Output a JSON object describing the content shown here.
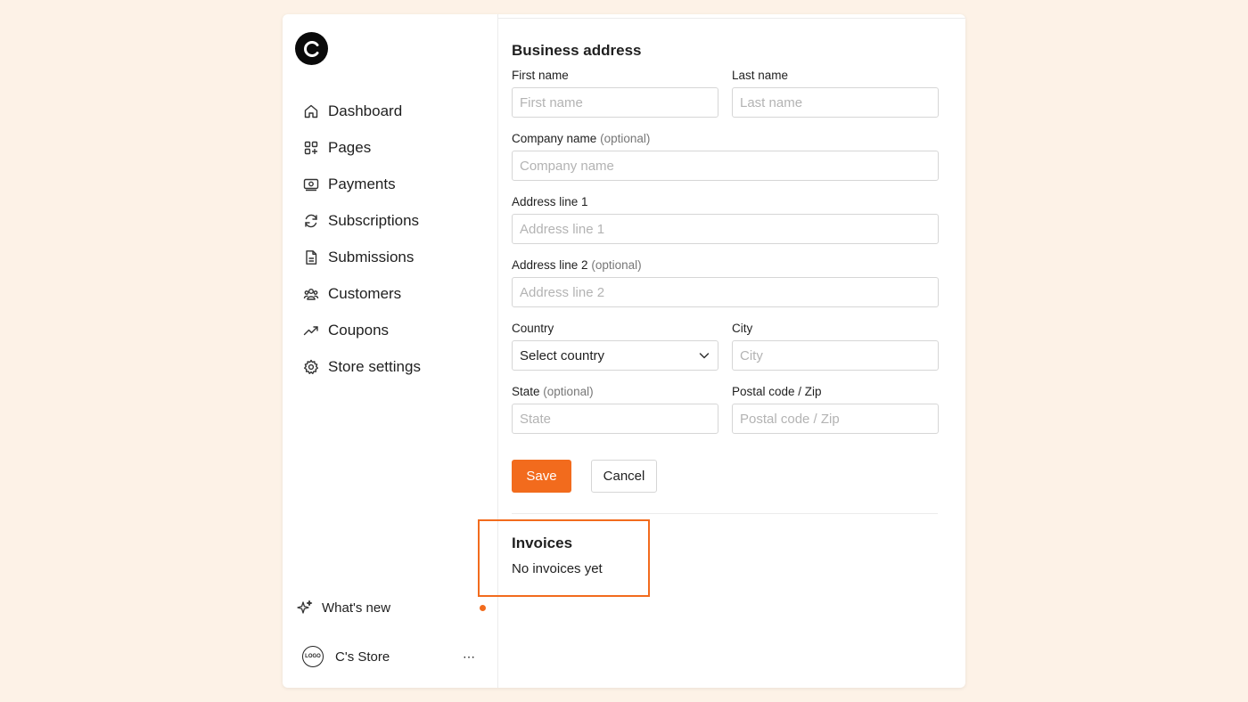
{
  "sidebar": {
    "logo_icon": "brand-c-logo-icon",
    "items": [
      {
        "label": "Dashboard",
        "icon": "home-icon"
      },
      {
        "label": "Pages",
        "icon": "grid-plus-icon"
      },
      {
        "label": "Payments",
        "icon": "banknote-icon"
      },
      {
        "label": "Subscriptions",
        "icon": "refresh-icon"
      },
      {
        "label": "Submissions",
        "icon": "document-icon"
      },
      {
        "label": "Customers",
        "icon": "users-icon"
      },
      {
        "label": "Coupons",
        "icon": "trending-up-icon"
      },
      {
        "label": "Store settings",
        "icon": "gear-icon"
      }
    ],
    "whats_new": "What's new",
    "store": {
      "name": "C's Store",
      "avatar_text": "LOGO",
      "more": "⋯"
    }
  },
  "colors": {
    "accent": "#f26b1d",
    "background": "#fdf2e7"
  },
  "business_address": {
    "title": "Business address",
    "first_name": {
      "label": "First name",
      "placeholder": "First name",
      "value": ""
    },
    "last_name": {
      "label": "Last name",
      "placeholder": "Last name",
      "value": ""
    },
    "company": {
      "label": "Company name",
      "optional": "(optional)",
      "placeholder": "Company name",
      "value": ""
    },
    "address1": {
      "label": "Address line 1",
      "placeholder": "Address line 1",
      "value": ""
    },
    "address2": {
      "label": "Address line 2",
      "optional": "(optional)",
      "placeholder": "Address line 2",
      "value": ""
    },
    "country": {
      "label": "Country",
      "selected": "Select country"
    },
    "city": {
      "label": "City",
      "placeholder": "City",
      "value": ""
    },
    "state": {
      "label": "State",
      "optional": "(optional)",
      "placeholder": "State",
      "value": ""
    },
    "postal": {
      "label": "Postal code / Zip",
      "placeholder": "Postal code / Zip",
      "value": ""
    },
    "save": "Save",
    "cancel": "Cancel"
  },
  "invoices": {
    "title": "Invoices",
    "empty": "No invoices yet"
  }
}
